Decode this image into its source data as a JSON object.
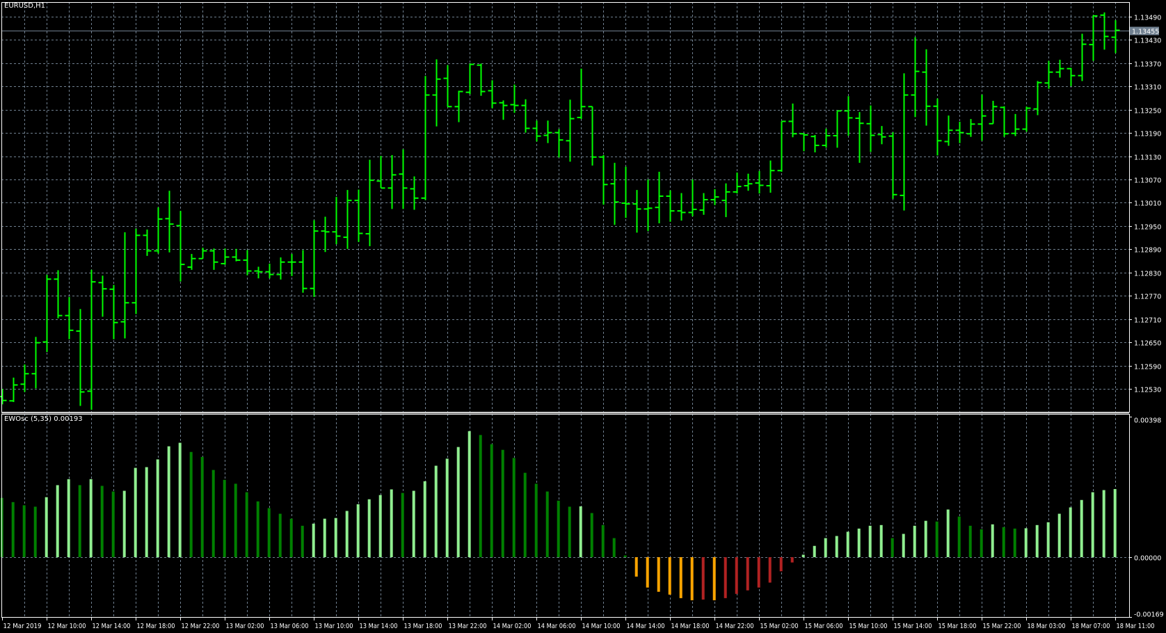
{
  "header": {
    "symbol_timeframe": "EURUSD,H1"
  },
  "indicator": {
    "label": "EWOsc (5,35) 0.00193"
  },
  "colors": {
    "background": "#000000",
    "grid": "#708090",
    "bar": "#00ff00",
    "axis": "#ffffff",
    "osc_up_positive": "#90ee90",
    "osc_down_positive": "#008000",
    "osc_down_negative": "#ffa500",
    "osc_up_negative": "#b22222",
    "current_price_label_bg": "#708090"
  },
  "chart_data": [
    {
      "type": "ohlc",
      "title": "EURUSD,H1",
      "ylim": [
        1.125,
        1.1352
      ],
      "y_ticks": [
        "1.13490",
        "1.13430",
        "1.13370",
        "1.13310",
        "1.13250",
        "1.13190",
        "1.13130",
        "1.13070",
        "1.13010",
        "1.12950",
        "1.12890",
        "1.12830",
        "1.12770",
        "1.12710",
        "1.12650",
        "1.12590",
        "1.12530"
      ],
      "current_price": "1.13455",
      "x_ticks": [
        {
          "bar": 0,
          "label": "12 Mar 2019"
        },
        {
          "bar": 4,
          "label": "12 Mar 10:00"
        },
        {
          "bar": 8,
          "label": "12 Mar 14:00"
        },
        {
          "bar": 12,
          "label": "12 Mar 18:00"
        },
        {
          "bar": 16,
          "label": "12 Mar 22:00"
        },
        {
          "bar": 20,
          "label": "13 Mar 02:00"
        },
        {
          "bar": 24,
          "label": "13 Mar 06:00"
        },
        {
          "bar": 28,
          "label": "13 Mar 10:00"
        },
        {
          "bar": 32,
          "label": "13 Mar 14:00"
        },
        {
          "bar": 36,
          "label": "13 Mar 18:00"
        },
        {
          "bar": 40,
          "label": "13 Mar 22:00"
        },
        {
          "bar": 44,
          "label": "14 Mar 02:00"
        },
        {
          "bar": 48,
          "label": "14 Mar 06:00"
        },
        {
          "bar": 52,
          "label": "14 Mar 10:00"
        },
        {
          "bar": 56,
          "label": "14 Mar 14:00"
        },
        {
          "bar": 60,
          "label": "14 Mar 18:00"
        },
        {
          "bar": 64,
          "label": "14 Mar 22:00"
        },
        {
          "bar": 68,
          "label": "15 Mar 02:00"
        },
        {
          "bar": 72,
          "label": "15 Mar 06:00"
        },
        {
          "bar": 76,
          "label": "15 Mar 10:00"
        },
        {
          "bar": 80,
          "label": "15 Mar 14:00"
        },
        {
          "bar": 84,
          "label": "15 Mar 18:00"
        },
        {
          "bar": 88,
          "label": "15 Mar 22:00"
        },
        {
          "bar": 92,
          "label": "18 Mar 03:00"
        },
        {
          "bar": 96,
          "label": "18 Mar 07:00"
        },
        {
          "bar": 100,
          "label": "18 Mar 11:00"
        }
      ],
      "ohlc_fields": [
        "open",
        "high",
        "low",
        "close"
      ],
      "bars": [
        [
          1.1251,
          1.1253,
          1.1249,
          1.125
        ],
        [
          1.12499,
          1.12559,
          1.12496,
          1.1254
        ],
        [
          1.12542,
          1.12593,
          1.12522,
          1.12569
        ],
        [
          1.12569,
          1.12664,
          1.12531,
          1.12649
        ],
        [
          1.12651,
          1.12824,
          1.12625,
          1.12813
        ],
        [
          1.12813,
          1.12836,
          1.12712,
          1.12719
        ],
        [
          1.12719,
          1.12767,
          1.12658,
          1.12681
        ],
        [
          1.12679,
          1.12736,
          1.12486,
          1.12522
        ],
        [
          1.12524,
          1.12837,
          1.12476,
          1.12806
        ],
        [
          1.12804,
          1.12822,
          1.12716,
          1.12788
        ],
        [
          1.12787,
          1.12798,
          1.12658,
          1.12701
        ],
        [
          1.12703,
          1.12934,
          1.1266,
          1.12752
        ],
        [
          1.12752,
          1.12943,
          1.12723,
          1.12926
        ],
        [
          1.12926,
          1.12941,
          1.12873,
          1.12886
        ],
        [
          1.12886,
          1.12998,
          1.12879,
          1.12968
        ],
        [
          1.12969,
          1.13041,
          1.12882,
          1.12955
        ],
        [
          1.12951,
          1.12989,
          1.12807,
          1.12851
        ],
        [
          1.12844,
          1.12878,
          1.12837,
          1.12866
        ],
        [
          1.12866,
          1.12894,
          1.12866,
          1.12886
        ],
        [
          1.12886,
          1.12892,
          1.12837,
          1.12857
        ],
        [
          1.12853,
          1.12892,
          1.1285,
          1.1287
        ],
        [
          1.1287,
          1.12891,
          1.12859,
          1.12862
        ],
        [
          1.12862,
          1.12888,
          1.12823,
          1.12834
        ],
        [
          1.12834,
          1.12845,
          1.12815,
          1.12832
        ],
        [
          1.12832,
          1.12853,
          1.12815,
          1.12825
        ],
        [
          1.12825,
          1.12869,
          1.12812,
          1.12857
        ],
        [
          1.12857,
          1.12878,
          1.12821,
          1.12857
        ],
        [
          1.12857,
          1.12888,
          1.12778,
          1.12789
        ],
        [
          1.12789,
          1.12965,
          1.12767,
          1.12937
        ],
        [
          1.12937,
          1.12974,
          1.12883,
          1.12935
        ],
        [
          1.12935,
          1.13025,
          1.12903,
          1.12924
        ],
        [
          1.12921,
          1.13043,
          1.12891,
          1.13016
        ],
        [
          1.13016,
          1.13044,
          1.12909,
          1.12931
        ],
        [
          1.1293,
          1.13121,
          1.12898,
          1.13068
        ],
        [
          1.13066,
          1.13131,
          1.13048,
          1.13048
        ],
        [
          1.13048,
          1.13133,
          1.12994,
          1.13082
        ],
        [
          1.13084,
          1.13148,
          1.12994,
          1.13048
        ],
        [
          1.13046,
          1.13078,
          1.12992,
          1.13022
        ],
        [
          1.13022,
          1.13337,
          1.13017,
          1.13288
        ],
        [
          1.13288,
          1.1338,
          1.13207,
          1.13329
        ],
        [
          1.13331,
          1.13365,
          1.13258,
          1.13258
        ],
        [
          1.13258,
          1.13299,
          1.13218,
          1.13297
        ],
        [
          1.13295,
          1.13369,
          1.1329,
          1.13367
        ],
        [
          1.13365,
          1.13369,
          1.13286,
          1.13297
        ],
        [
          1.13299,
          1.13326,
          1.13254,
          1.13267
        ],
        [
          1.13268,
          1.13274,
          1.13224,
          1.13261
        ],
        [
          1.13263,
          1.13315,
          1.13242,
          1.13261
        ],
        [
          1.13261,
          1.13277,
          1.13191,
          1.13202
        ],
        [
          1.13202,
          1.13222,
          1.13168,
          1.13182
        ],
        [
          1.13184,
          1.13222,
          1.13164,
          1.13191
        ],
        [
          1.13191,
          1.132,
          1.13127,
          1.13172
        ],
        [
          1.1317,
          1.13276,
          1.13116,
          1.13227
        ],
        [
          1.1323,
          1.13356,
          1.13226,
          1.13258
        ],
        [
          1.13258,
          1.13258,
          1.13106,
          1.13128
        ],
        [
          1.13128,
          1.13133,
          1.13005,
          1.13057
        ],
        [
          1.13059,
          1.13113,
          1.12953,
          1.13012
        ],
        [
          1.13009,
          1.13103,
          1.12971,
          1.13007
        ],
        [
          1.13007,
          1.13043,
          1.12933,
          1.12994
        ],
        [
          1.12994,
          1.1307,
          1.12937,
          1.12996
        ],
        [
          1.12998,
          1.1309,
          1.12957,
          1.13027
        ],
        [
          1.13027,
          1.13042,
          1.12961,
          1.12989
        ],
        [
          1.12989,
          1.13035,
          1.12964,
          1.12985
        ],
        [
          1.12985,
          1.1307,
          1.12975,
          1.12993
        ],
        [
          1.12991,
          1.13035,
          1.12979,
          1.13018
        ],
        [
          1.13018,
          1.13045,
          1.13004,
          1.13025
        ],
        [
          1.13016,
          1.1306,
          1.12973,
          1.13038
        ],
        [
          1.13038,
          1.13088,
          1.13034,
          1.13052
        ],
        [
          1.13054,
          1.13085,
          1.13041,
          1.13059
        ],
        [
          1.13061,
          1.13092,
          1.13034,
          1.13055
        ],
        [
          1.13054,
          1.13119,
          1.13036,
          1.13093
        ],
        [
          1.13093,
          1.1322,
          1.1309,
          1.1322
        ],
        [
          1.1322,
          1.13266,
          1.13179,
          1.13188
        ],
        [
          1.13188,
          1.13188,
          1.13143,
          1.13185
        ],
        [
          1.13181,
          1.13185,
          1.1314,
          1.13158
        ],
        [
          1.13158,
          1.13201,
          1.13152,
          1.13183
        ],
        [
          1.13183,
          1.13247,
          1.13152,
          1.13247
        ],
        [
          1.13247,
          1.13285,
          1.13183,
          1.13229
        ],
        [
          1.13228,
          1.13244,
          1.13113,
          1.13215
        ],
        [
          1.13214,
          1.13261,
          1.13141,
          1.13184
        ],
        [
          1.13186,
          1.13208,
          1.13161,
          1.1318
        ],
        [
          1.13182,
          1.13192,
          1.1302,
          1.13031
        ],
        [
          1.13029,
          1.13344,
          1.1299,
          1.13288
        ],
        [
          1.13288,
          1.13437,
          1.13231,
          1.13349
        ],
        [
          1.13347,
          1.13406,
          1.13209,
          1.13259
        ],
        [
          1.13259,
          1.13279,
          1.13132,
          1.1317
        ],
        [
          1.13168,
          1.13235,
          1.13157,
          1.13197
        ],
        [
          1.13197,
          1.13219,
          1.13164,
          1.13191
        ],
        [
          1.13188,
          1.13226,
          1.1318,
          1.13213
        ],
        [
          1.13213,
          1.13289,
          1.1317,
          1.13234
        ],
        [
          1.13214,
          1.13273,
          1.13214,
          1.13258
        ],
        [
          1.13256,
          1.13259,
          1.1318,
          1.13188
        ],
        [
          1.13189,
          1.13239,
          1.13182,
          1.132
        ],
        [
          1.132,
          1.13258,
          1.13193,
          1.13254
        ],
        [
          1.13252,
          1.13324,
          1.13236,
          1.1332
        ],
        [
          1.13319,
          1.13376,
          1.13304,
          1.13347
        ],
        [
          1.13347,
          1.13379,
          1.13333,
          1.13356
        ],
        [
          1.13356,
          1.13358,
          1.13311,
          1.13338
        ],
        [
          1.13338,
          1.13446,
          1.13324,
          1.13419
        ],
        [
          1.13418,
          1.13494,
          1.13376,
          1.13492
        ],
        [
          1.13494,
          1.13501,
          1.13405,
          1.13439
        ],
        [
          1.13437,
          1.13481,
          1.13396,
          1.13455
        ]
      ]
    },
    {
      "type": "bar",
      "title": "EWOsc (5,35)",
      "ylim": [
        -0.00169,
        0.00398
      ],
      "y_ticks": [
        "0.00398",
        "0.00000",
        "-0.00169"
      ],
      "values": [
        0.00168,
        0.00156,
        0.00147,
        0.00143,
        0.0017,
        0.00204,
        0.00221,
        0.00204,
        0.00221,
        0.00202,
        0.00186,
        0.00188,
        0.00253,
        0.00255,
        0.00277,
        0.00314,
        0.00324,
        0.00298,
        0.00284,
        0.00247,
        0.00219,
        0.00208,
        0.00184,
        0.00158,
        0.00139,
        0.00123,
        0.00109,
        0.00089,
        0.00095,
        0.00109,
        0.00111,
        0.00131,
        0.0015,
        0.00164,
        0.00176,
        0.00192,
        0.00182,
        0.00188,
        0.00215,
        0.00259,
        0.00279,
        0.00312,
        0.00357,
        0.00346,
        0.0032,
        0.00304,
        0.00281,
        0.00239,
        0.00208,
        0.00186,
        0.0016,
        0.00143,
        0.00144,
        0.00125,
        0.00091,
        0.00054,
        5e-05,
        -0.00055,
        -0.00086,
        -0.00098,
        -0.00106,
        -0.00116,
        -0.00122,
        -0.0012,
        -0.00122,
        -0.00116,
        -0.00104,
        -0.00094,
        -0.00086,
        -0.00072,
        -0.0004,
        -0.00015,
        7e-05,
        0.00032,
        0.00054,
        0.0006,
        0.00072,
        0.00081,
        0.00089,
        0.00091,
        0.00054,
        0.00066,
        0.00089,
        0.00103,
        0.00101,
        0.00135,
        0.00115,
        0.00089,
        0.00079,
        0.00093,
        0.00085,
        0.00081,
        0.00082,
        0.00091,
        0.00099,
        0.00123,
        0.00141,
        0.00162,
        0.00184,
        0.0019,
        0.00193
      ]
    }
  ]
}
